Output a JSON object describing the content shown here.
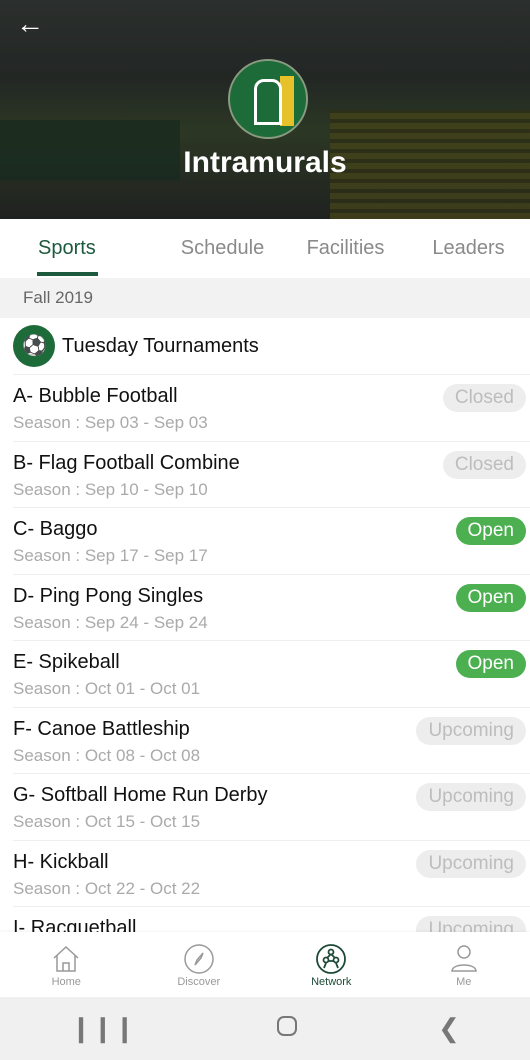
{
  "header": {
    "title": "Intramurals",
    "back_icon": "arrow-left-icon"
  },
  "tabs": [
    {
      "label": "Sports",
      "active": true
    },
    {
      "label": "Schedule"
    },
    {
      "label": "Facilities"
    },
    {
      "label": "Leaders"
    }
  ],
  "term": "Fall 2019",
  "group": {
    "title": "Tuesday Tournaments"
  },
  "items": [
    {
      "name": "A- Bubble Football",
      "season": "Season : Sep 03 - Sep 03",
      "status": "Closed"
    },
    {
      "name": "B- Flag Football Combine",
      "season": "Season : Sep 10 - Sep 10",
      "status": "Closed"
    },
    {
      "name": "C- Baggo",
      "season": "Season : Sep 17 - Sep 17",
      "status": "Open"
    },
    {
      "name": "D- Ping Pong Singles",
      "season": "Season : Sep 24 - Sep 24",
      "status": "Open"
    },
    {
      "name": "E- Spikeball",
      "season": "Season : Oct 01 - Oct 01",
      "status": "Open"
    },
    {
      "name": "F- Canoe Battleship",
      "season": "Season : Oct 08 - Oct 08",
      "status": "Upcoming"
    },
    {
      "name": "G- Softball Home Run Derby",
      "season": "Season : Oct 15 - Oct 15",
      "status": "Upcoming"
    },
    {
      "name": "H- Kickball",
      "season": "Season : Oct 22 - Oct 22",
      "status": "Upcoming"
    },
    {
      "name": "I- Racquetball",
      "season": "",
      "status": "Upcoming"
    }
  ],
  "nav": [
    {
      "label": "Home"
    },
    {
      "label": "Discover"
    },
    {
      "label": "Network",
      "active": true
    },
    {
      "label": "Me"
    }
  ],
  "colors": {
    "primary": "#1d5a3d",
    "open": "#4caf50",
    "closed_bg": "#ededed"
  }
}
